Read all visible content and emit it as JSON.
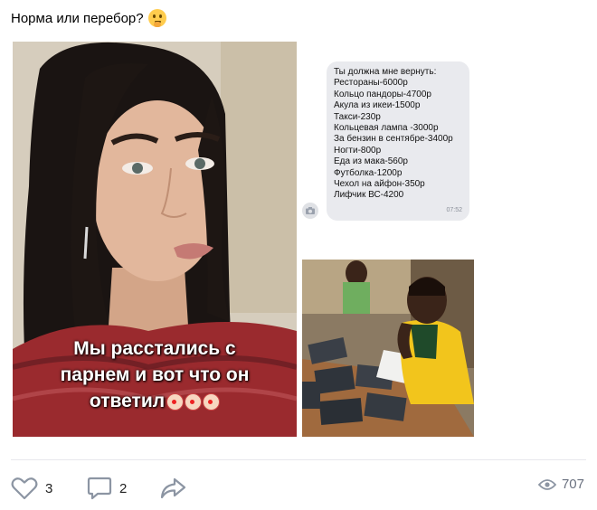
{
  "post": {
    "text": "Норма или перебор?",
    "emoji": "thinking-face-icon"
  },
  "photo_main": {
    "caption_line1": "Мы расстались с",
    "caption_line2": "парнем и вот что он",
    "caption_line3": "ответил"
  },
  "chat": {
    "lines": [
      "Ты должна мне вернуть:",
      "Рестораны-6000р",
      "Кольцо пандоры-4700р",
      "Акула из икеи-1500р",
      "Такси-230р",
      "Кольцевая лампа -3000р",
      "За бензин в сентябре-3400р",
      "Ногти-800р",
      "Еда из мака-560р",
      "Футболка-1200р",
      "Чехол на айфон-350р",
      "Лифчик ВС-4200"
    ],
    "time": "07:52"
  },
  "footer": {
    "likes": "3",
    "comments": "2",
    "views": "707"
  },
  "colors": {
    "icon_gray": "#8c95a3",
    "bubble_bg": "#e9eaee",
    "divider": "#e7e8ec"
  }
}
